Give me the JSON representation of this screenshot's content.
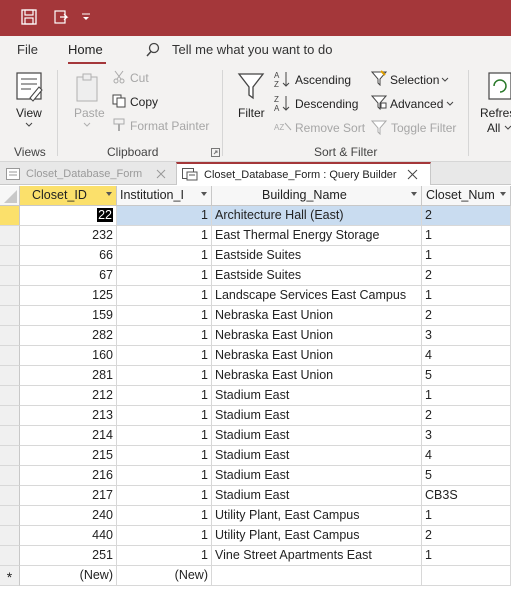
{
  "menu": {
    "file": "File",
    "home": "Home",
    "tell_me": "Tell me what you want to do"
  },
  "ribbon": {
    "views": {
      "view_label": "View",
      "group_label": "Views"
    },
    "clipboard": {
      "paste": "Paste",
      "cut": "Cut",
      "copy": "Copy",
      "format_painter": "Format Painter",
      "group_label": "Clipboard"
    },
    "sort_filter": {
      "filter": "Filter",
      "ascending": "Ascending",
      "descending": "Descending",
      "remove_sort": "Remove Sort",
      "selection": "Selection",
      "advanced": "Advanced",
      "toggle_filter": "Toggle Filter",
      "group_label": "Sort & Filter"
    },
    "records": {
      "refresh": "Refresh",
      "all": "All"
    }
  },
  "doc_tabs": [
    {
      "label": "Closet_Database_Form"
    },
    {
      "label": "Closet_Database_Form : Query Builder"
    }
  ],
  "grid": {
    "columns": [
      "Closet_ID",
      "Institution_I",
      "Building_Name",
      "Closet_Num"
    ],
    "rows": [
      {
        "id": "22",
        "inst": "1",
        "name": "Architecture Hall (East)",
        "num": "2"
      },
      {
        "id": "232",
        "inst": "1",
        "name": "East Thermal Energy Storage",
        "num": "1"
      },
      {
        "id": "66",
        "inst": "1",
        "name": "Eastside Suites",
        "num": "1"
      },
      {
        "id": "67",
        "inst": "1",
        "name": "Eastside Suites",
        "num": "2"
      },
      {
        "id": "125",
        "inst": "1",
        "name": "Landscape Services East Campus",
        "num": "1"
      },
      {
        "id": "159",
        "inst": "1",
        "name": "Nebraska East Union",
        "num": "2"
      },
      {
        "id": "282",
        "inst": "1",
        "name": "Nebraska East Union",
        "num": "3"
      },
      {
        "id": "160",
        "inst": "1",
        "name": "Nebraska East Union",
        "num": "4"
      },
      {
        "id": "281",
        "inst": "1",
        "name": "Nebraska East Union",
        "num": "5"
      },
      {
        "id": "212",
        "inst": "1",
        "name": "Stadium East",
        "num": "1"
      },
      {
        "id": "213",
        "inst": "1",
        "name": "Stadium East",
        "num": "2"
      },
      {
        "id": "214",
        "inst": "1",
        "name": "Stadium East",
        "num": "3"
      },
      {
        "id": "215",
        "inst": "1",
        "name": "Stadium East",
        "num": "4"
      },
      {
        "id": "216",
        "inst": "1",
        "name": "Stadium East",
        "num": "5"
      },
      {
        "id": "217",
        "inst": "1",
        "name": "Stadium East",
        "num": "CB3S"
      },
      {
        "id": "240",
        "inst": "1",
        "name": "Utility Plant, East Campus",
        "num": "1"
      },
      {
        "id": "440",
        "inst": "1",
        "name": "Utility Plant, East Campus",
        "num": "2"
      },
      {
        "id": "251",
        "inst": "1",
        "name": "Vine Street Apartments East",
        "num": "1"
      }
    ],
    "new_row": {
      "marker": "*",
      "id": "(New)",
      "inst": "(New)"
    }
  },
  "colors": {
    "title_bar": "#a4373a",
    "selected_header": "#fbe06b",
    "highlight_row": "#c9dcf0"
  }
}
